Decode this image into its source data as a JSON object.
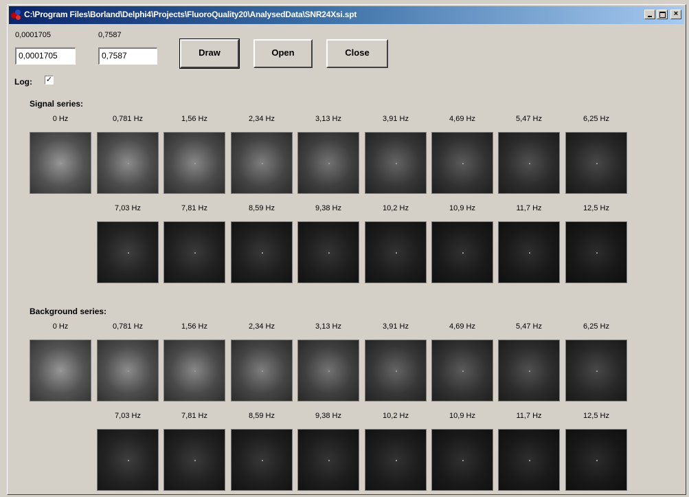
{
  "window": {
    "title": "C:\\Program Files\\Borland\\Delphi4\\Projects\\FluoroQuality20\\AnalysedData\\SNR24Xsi.spt",
    "minimize_glyph": "_",
    "maximize_glyph": "□",
    "close_glyph": "×"
  },
  "controls": {
    "min_label": "0,0001705",
    "min_value": "0,0001705",
    "max_label": "0,7587",
    "max_value": "0,7587",
    "draw_label": "Draw",
    "open_label": "Open",
    "close_label": "Close",
    "log_label": "Log:",
    "log_checked": true,
    "check_glyph": "✓"
  },
  "signal_series": {
    "title": "Signal series:",
    "row1_freqs": [
      "0 Hz",
      "0,781 Hz",
      "1,56 Hz",
      "2,34 Hz",
      "3,13 Hz",
      "3,91 Hz",
      "4,69 Hz",
      "5,47 Hz",
      "6,25 Hz"
    ],
    "row2_freqs": [
      "7,03 Hz",
      "7,81 Hz",
      "8,59 Hz",
      "9,38 Hz",
      "10,2 Hz",
      "10,9 Hz",
      "11,7 Hz",
      "12,5 Hz"
    ]
  },
  "background_series": {
    "title": "Background series:",
    "row1_freqs": [
      "0 Hz",
      "0,781 Hz",
      "1,56 Hz",
      "2,34 Hz",
      "3,13 Hz",
      "3,91 Hz",
      "4,69 Hz",
      "5,47 Hz",
      "6,25 Hz"
    ],
    "row2_freqs": [
      "7,03 Hz",
      "7,81 Hz",
      "8,59 Hz",
      "9,38 Hz",
      "10,2 Hz",
      "10,9 Hz",
      "11,7 Hz",
      "12,5 Hz"
    ]
  },
  "colors": {
    "title_gradient_start": "#0a246a",
    "title_gradient_end": "#a6caf0",
    "face": "#d4d0c8"
  }
}
